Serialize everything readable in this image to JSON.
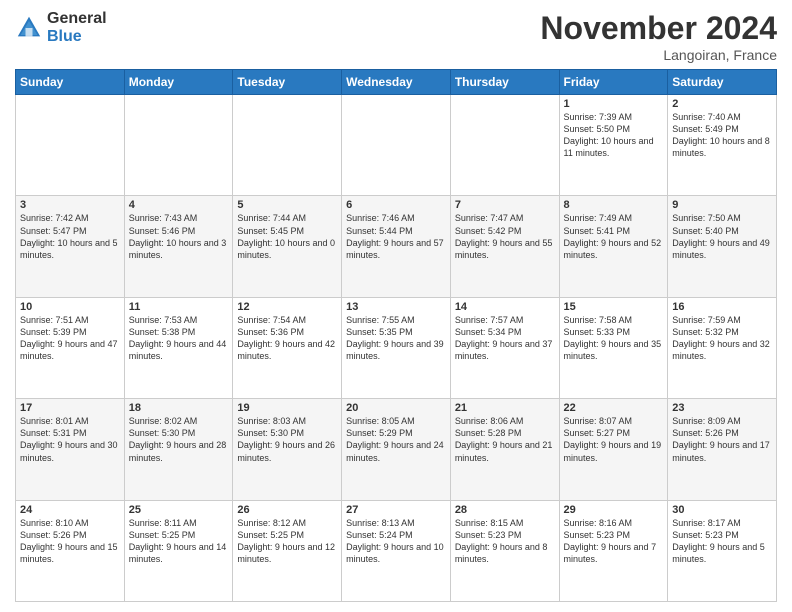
{
  "header": {
    "logo_general": "General",
    "logo_blue": "Blue",
    "month_title": "November 2024",
    "location": "Langoiran, France"
  },
  "weekdays": [
    "Sunday",
    "Monday",
    "Tuesday",
    "Wednesday",
    "Thursday",
    "Friday",
    "Saturday"
  ],
  "weeks": [
    [
      {
        "day": "",
        "info": ""
      },
      {
        "day": "",
        "info": ""
      },
      {
        "day": "",
        "info": ""
      },
      {
        "day": "",
        "info": ""
      },
      {
        "day": "",
        "info": ""
      },
      {
        "day": "1",
        "info": "Sunrise: 7:39 AM\nSunset: 5:50 PM\nDaylight: 10 hours and 11 minutes."
      },
      {
        "day": "2",
        "info": "Sunrise: 7:40 AM\nSunset: 5:49 PM\nDaylight: 10 hours and 8 minutes."
      }
    ],
    [
      {
        "day": "3",
        "info": "Sunrise: 7:42 AM\nSunset: 5:47 PM\nDaylight: 10 hours and 5 minutes."
      },
      {
        "day": "4",
        "info": "Sunrise: 7:43 AM\nSunset: 5:46 PM\nDaylight: 10 hours and 3 minutes."
      },
      {
        "day": "5",
        "info": "Sunrise: 7:44 AM\nSunset: 5:45 PM\nDaylight: 10 hours and 0 minutes."
      },
      {
        "day": "6",
        "info": "Sunrise: 7:46 AM\nSunset: 5:44 PM\nDaylight: 9 hours and 57 minutes."
      },
      {
        "day": "7",
        "info": "Sunrise: 7:47 AM\nSunset: 5:42 PM\nDaylight: 9 hours and 55 minutes."
      },
      {
        "day": "8",
        "info": "Sunrise: 7:49 AM\nSunset: 5:41 PM\nDaylight: 9 hours and 52 minutes."
      },
      {
        "day": "9",
        "info": "Sunrise: 7:50 AM\nSunset: 5:40 PM\nDaylight: 9 hours and 49 minutes."
      }
    ],
    [
      {
        "day": "10",
        "info": "Sunrise: 7:51 AM\nSunset: 5:39 PM\nDaylight: 9 hours and 47 minutes."
      },
      {
        "day": "11",
        "info": "Sunrise: 7:53 AM\nSunset: 5:38 PM\nDaylight: 9 hours and 44 minutes."
      },
      {
        "day": "12",
        "info": "Sunrise: 7:54 AM\nSunset: 5:36 PM\nDaylight: 9 hours and 42 minutes."
      },
      {
        "day": "13",
        "info": "Sunrise: 7:55 AM\nSunset: 5:35 PM\nDaylight: 9 hours and 39 minutes."
      },
      {
        "day": "14",
        "info": "Sunrise: 7:57 AM\nSunset: 5:34 PM\nDaylight: 9 hours and 37 minutes."
      },
      {
        "day": "15",
        "info": "Sunrise: 7:58 AM\nSunset: 5:33 PM\nDaylight: 9 hours and 35 minutes."
      },
      {
        "day": "16",
        "info": "Sunrise: 7:59 AM\nSunset: 5:32 PM\nDaylight: 9 hours and 32 minutes."
      }
    ],
    [
      {
        "day": "17",
        "info": "Sunrise: 8:01 AM\nSunset: 5:31 PM\nDaylight: 9 hours and 30 minutes."
      },
      {
        "day": "18",
        "info": "Sunrise: 8:02 AM\nSunset: 5:30 PM\nDaylight: 9 hours and 28 minutes."
      },
      {
        "day": "19",
        "info": "Sunrise: 8:03 AM\nSunset: 5:30 PM\nDaylight: 9 hours and 26 minutes."
      },
      {
        "day": "20",
        "info": "Sunrise: 8:05 AM\nSunset: 5:29 PM\nDaylight: 9 hours and 24 minutes."
      },
      {
        "day": "21",
        "info": "Sunrise: 8:06 AM\nSunset: 5:28 PM\nDaylight: 9 hours and 21 minutes."
      },
      {
        "day": "22",
        "info": "Sunrise: 8:07 AM\nSunset: 5:27 PM\nDaylight: 9 hours and 19 minutes."
      },
      {
        "day": "23",
        "info": "Sunrise: 8:09 AM\nSunset: 5:26 PM\nDaylight: 9 hours and 17 minutes."
      }
    ],
    [
      {
        "day": "24",
        "info": "Sunrise: 8:10 AM\nSunset: 5:26 PM\nDaylight: 9 hours and 15 minutes."
      },
      {
        "day": "25",
        "info": "Sunrise: 8:11 AM\nSunset: 5:25 PM\nDaylight: 9 hours and 14 minutes."
      },
      {
        "day": "26",
        "info": "Sunrise: 8:12 AM\nSunset: 5:25 PM\nDaylight: 9 hours and 12 minutes."
      },
      {
        "day": "27",
        "info": "Sunrise: 8:13 AM\nSunset: 5:24 PM\nDaylight: 9 hours and 10 minutes."
      },
      {
        "day": "28",
        "info": "Sunrise: 8:15 AM\nSunset: 5:23 PM\nDaylight: 9 hours and 8 minutes."
      },
      {
        "day": "29",
        "info": "Sunrise: 8:16 AM\nSunset: 5:23 PM\nDaylight: 9 hours and 7 minutes."
      },
      {
        "day": "30",
        "info": "Sunrise: 8:17 AM\nSunset: 5:23 PM\nDaylight: 9 hours and 5 minutes."
      }
    ]
  ]
}
